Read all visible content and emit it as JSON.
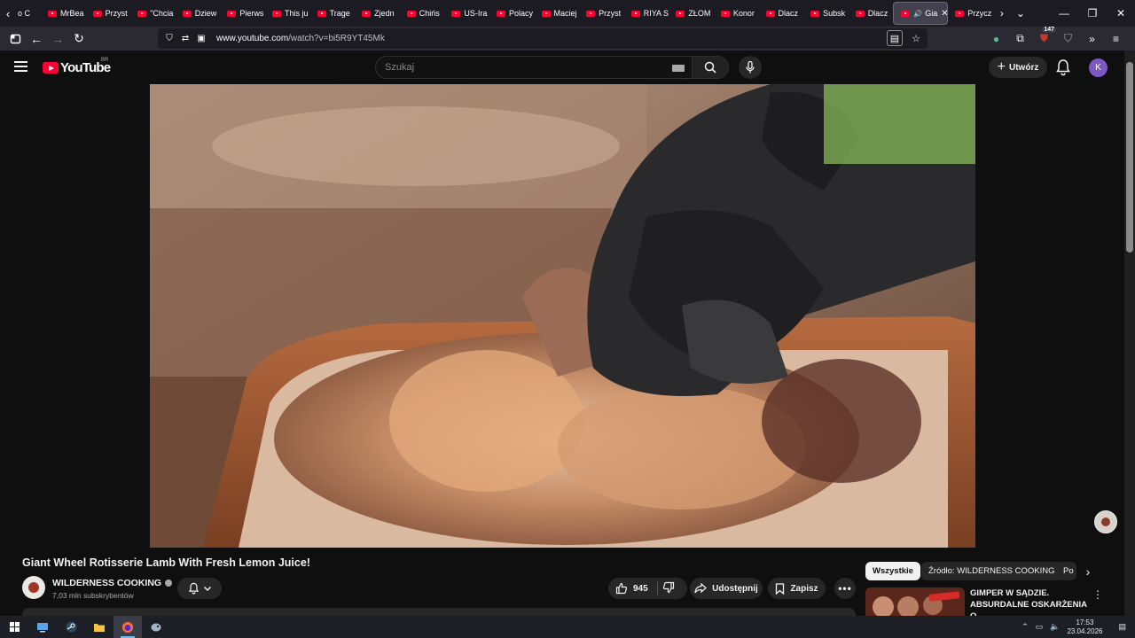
{
  "browser": {
    "tabs": [
      {
        "label": "MrBea"
      },
      {
        "label": "Przyst"
      },
      {
        "label": "\"Chcia"
      },
      {
        "label": "Dziew"
      },
      {
        "label": "Pierws"
      },
      {
        "label": "This ju"
      },
      {
        "label": "Trage"
      },
      {
        "label": "Zjedn"
      },
      {
        "label": "Chińs"
      },
      {
        "label": "US-Ira"
      },
      {
        "label": "Polacy"
      },
      {
        "label": "Maciej"
      },
      {
        "label": "Przyst"
      },
      {
        "label": "RIYA S"
      },
      {
        "label": "ZŁOM"
      },
      {
        "label": "Konor"
      },
      {
        "label": "Dlacz"
      },
      {
        "label": "Subsk"
      },
      {
        "label": "Dlacz"
      }
    ],
    "first_partial_tab": "o C",
    "active_tab": {
      "label": "Gia"
    },
    "next_tab": {
      "label": "Przycz"
    },
    "url_host": "www.youtube.com",
    "url_path": "/watch?v=bi5R9YT45Mk",
    "extensions_count": "147"
  },
  "youtube": {
    "logo_text": "YouTube",
    "region": "BR",
    "search_placeholder": "Szukaj",
    "create_label": "Utwórz",
    "avatar_letter": "K"
  },
  "video": {
    "title": "Giant Wheel Rotisserie Lamb With Fresh Lemon Juice!",
    "channel": "WILDERNESS COOKING",
    "subscribers": "7,03 mln subskrybentów",
    "likes": "945",
    "share_label": "Udostępnij",
    "save_label": "Zapisz"
  },
  "sidebar": {
    "chips": [
      {
        "label": "Wszystkie",
        "active": true
      },
      {
        "label": "Źródło: WILDERNESS COOKING",
        "active": false
      },
      {
        "label": "Po",
        "active": false
      }
    ],
    "recommended": [
      {
        "title_line1": "GIMPER W SĄDZIE.",
        "title_line2": "ABSURDALNE OSKARŻENIA O..."
      }
    ]
  },
  "taskbar": {
    "time": "17:53",
    "date": "23.04.2026"
  },
  "colors": {
    "yt_red": "#ff0033",
    "background": "#0f0f0f",
    "avatar": "#7e57c2"
  }
}
